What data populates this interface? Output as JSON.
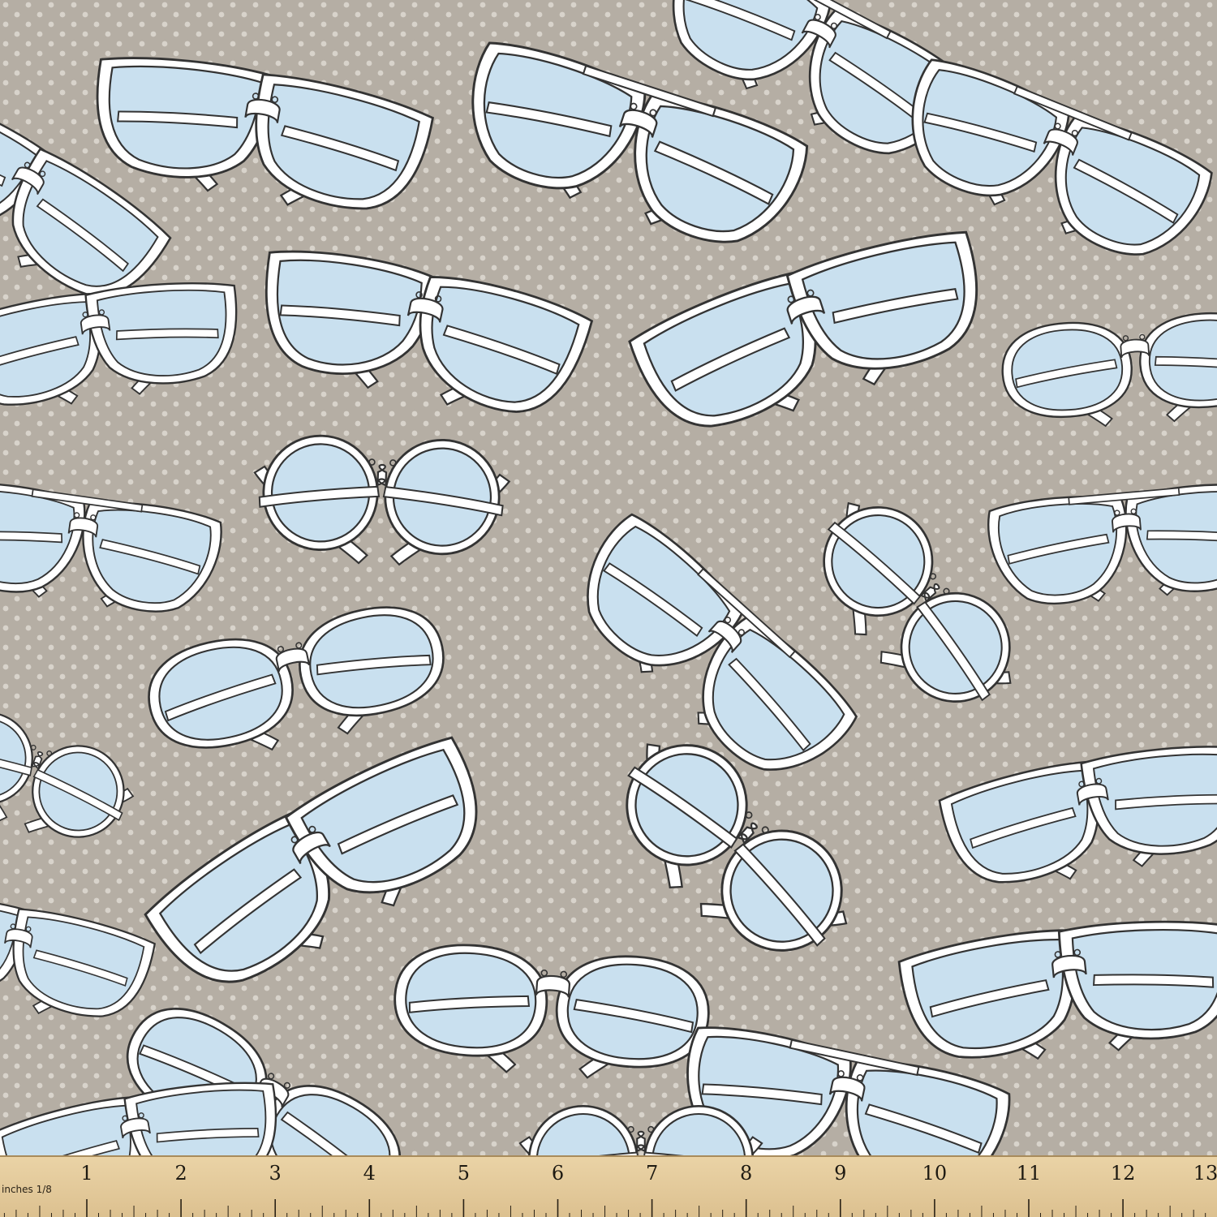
{
  "pattern": {
    "motif": "eyeglasses",
    "background_color": "#b5aea4",
    "dot_color": "#d8d3cb",
    "frame_color": "#ffffff",
    "outline_color": "#333333",
    "lens_color": "#c9e0ef",
    "glasses": [
      {
        "style": "cat-eye"
      },
      {
        "style": "aviator"
      },
      {
        "style": "aviator"
      },
      {
        "style": "aviator"
      },
      {
        "style": "cat-eye"
      },
      {
        "style": "cat-eye"
      },
      {
        "style": "butterfly"
      },
      {
        "style": "cat-eye"
      },
      {
        "style": "oval"
      },
      {
        "style": "round"
      },
      {
        "style": "round"
      },
      {
        "style": "aviator"
      },
      {
        "style": "aviator"
      },
      {
        "style": "aviator"
      },
      {
        "style": "oval"
      },
      {
        "style": "round"
      },
      {
        "style": "cat-eye"
      },
      {
        "style": "cat-eye"
      },
      {
        "style": "round"
      },
      {
        "style": "cat-eye"
      },
      {
        "style": "oval"
      },
      {
        "style": "cat-eye"
      },
      {
        "style": "aviator"
      },
      {
        "style": "oval"
      },
      {
        "style": "round"
      },
      {
        "style": "cat-eye"
      }
    ]
  },
  "ruler": {
    "unit_label": "inches 1/8",
    "numbers": [
      "1",
      "2",
      "3",
      "4",
      "5",
      "6",
      "7",
      "8",
      "9",
      "10",
      "11",
      "12",
      "13"
    ],
    "color": "#e6cd9d"
  }
}
